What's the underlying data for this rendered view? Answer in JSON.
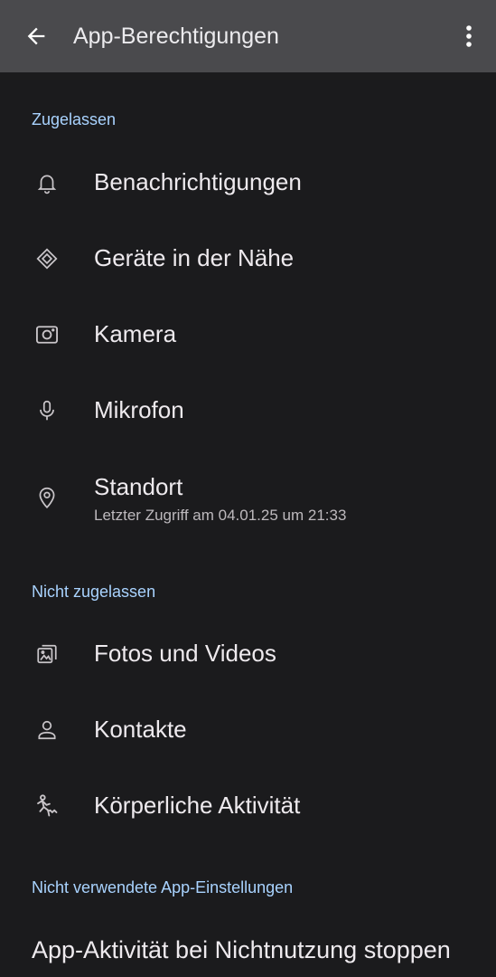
{
  "appbar": {
    "title": "App-Berechtigungen",
    "back_icon": "arrow-back-icon",
    "more_icon": "more-vert-icon"
  },
  "sections": {
    "allowed": {
      "header": "Zugelassen",
      "items": [
        {
          "label": "Benachrichtigungen",
          "icon": "bell-icon"
        },
        {
          "label": "Geräte in der Nähe",
          "icon": "nearby-devices-icon"
        },
        {
          "label": "Kamera",
          "icon": "camera-icon"
        },
        {
          "label": "Mikrofon",
          "icon": "microphone-icon"
        },
        {
          "label": "Standort",
          "subtitle": "Letzter Zugriff am 04.01.25 um 21:33",
          "icon": "location-pin-icon"
        }
      ]
    },
    "denied": {
      "header": "Nicht zugelassen",
      "items": [
        {
          "label": "Fotos und Videos",
          "icon": "photos-icon"
        },
        {
          "label": "Kontakte",
          "icon": "person-icon"
        },
        {
          "label": "Körperliche Aktivität",
          "icon": "physical-activity-icon"
        }
      ]
    },
    "unused": {
      "header": "Nicht verwendete App-Einstellungen",
      "item_label": "App-Aktivität bei Nichtnutzung stoppen"
    }
  },
  "colors": {
    "background": "#1b1b1d",
    "appbar": "#4a4a4d",
    "section_header": "#a9d3ff",
    "text_primary": "#eeeaee",
    "text_secondary": "#bdb9bd"
  }
}
